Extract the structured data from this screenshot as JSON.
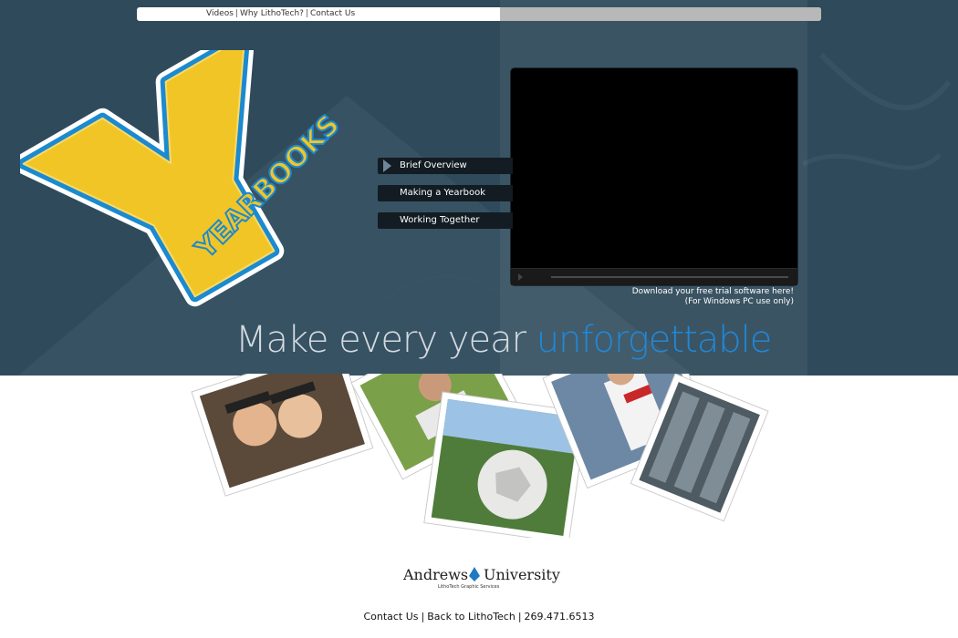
{
  "topnav": {
    "videos": "Videos",
    "why": "Why LithoTech?",
    "contact": "Contact Us",
    "sep": "|"
  },
  "logo": {
    "letter": "Y",
    "word": "YEARBOOKS"
  },
  "menu": [
    {
      "label": "Brief Overview",
      "active": true
    },
    {
      "label": "Making a Yearbook",
      "active": false
    },
    {
      "label": "Working Together",
      "active": false
    }
  ],
  "download": {
    "line1": "Download your free trial software here!",
    "line2": "(For Windows PC use only)"
  },
  "tagline": {
    "part1": "Make every year ",
    "part2": "unforgettable"
  },
  "university": {
    "name_left": "Andrews",
    "name_right": "University",
    "sub": "LithoTech Graphic Services"
  },
  "footer": {
    "contact": "Contact Us",
    "back": "Back to LithoTech",
    "phone": "269.471.6513",
    "sep": "|"
  },
  "colors": {
    "hero": "#2f4a5b",
    "accent_blue": "#1f88d8",
    "logo_yellow": "#f2c526",
    "logo_blue": "#1b8ad0"
  }
}
